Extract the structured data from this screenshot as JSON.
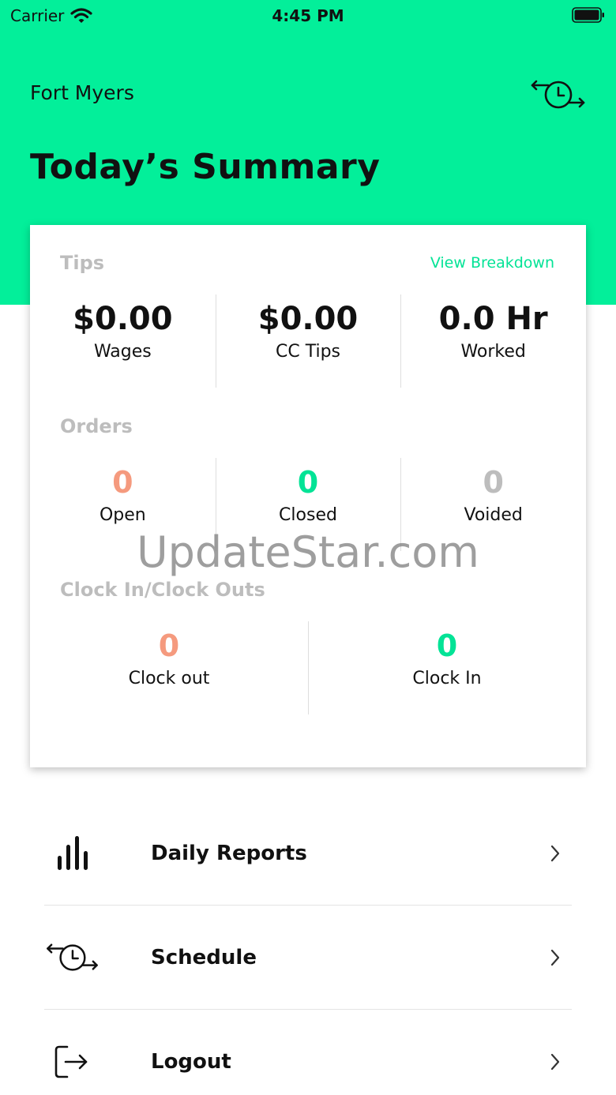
{
  "status_bar": {
    "carrier": "Carrier",
    "time": "4:45 PM",
    "icons": [
      "wifi-icon",
      "battery-icon"
    ]
  },
  "header": {
    "location": "Fort Myers",
    "title": "Today’s Summary",
    "background_color": "#03ef9a",
    "icon": "clock-swap-icon"
  },
  "summary": {
    "tips": {
      "label": "Tips",
      "link": "View Breakdown",
      "items": [
        {
          "value": "$0.00",
          "label": "Wages"
        },
        {
          "value": "$0.00",
          "label": "CC Tips"
        },
        {
          "value": "0.0 Hr",
          "label": "Worked"
        }
      ]
    },
    "orders": {
      "label": "Orders",
      "items": [
        {
          "value": "0",
          "label": "Open",
          "color": "#f59a7e"
        },
        {
          "value": "0",
          "label": "Closed",
          "color": "#03e396"
        },
        {
          "value": "0",
          "label": "Voided",
          "color": "#bdbdbd"
        }
      ]
    },
    "clock": {
      "label": "Clock In/Clock Outs",
      "items": [
        {
          "value": "0",
          "label": "Clock out",
          "color": "#f59a7e"
        },
        {
          "value": "0",
          "label": "Clock In",
          "color": "#03e396"
        }
      ]
    }
  },
  "watermark": "UpdateStar.com",
  "menu": [
    {
      "label": "Daily Reports",
      "icon": "bar-chart-icon"
    },
    {
      "label": "Schedule",
      "icon": "clock-swap-icon"
    },
    {
      "label": "Logout",
      "icon": "logout-icon"
    }
  ]
}
